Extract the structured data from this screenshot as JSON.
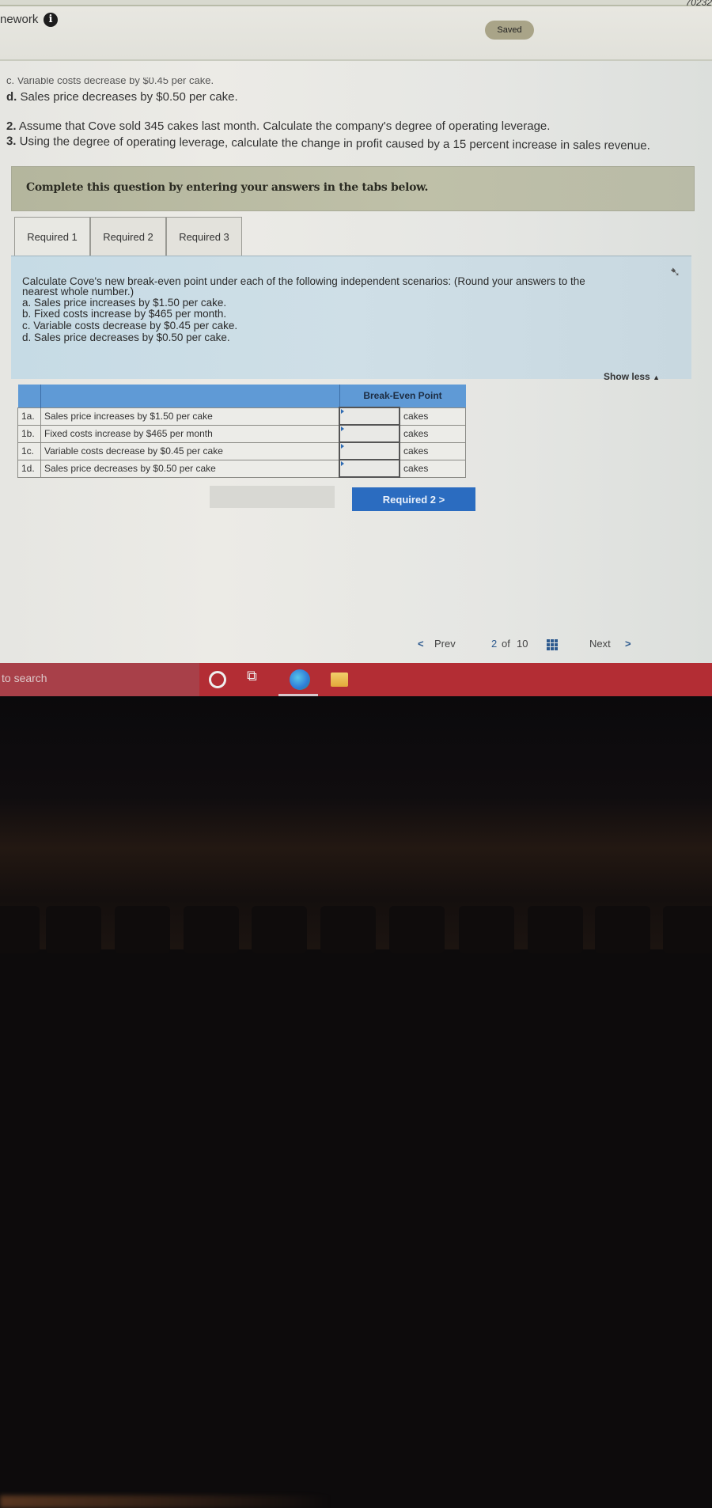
{
  "header": {
    "title": "nework",
    "info_icon": "info-icon",
    "saved_label": "Saved",
    "top_code": "70232"
  },
  "previous_text": {
    "line_c_cut": "c. Variable costs decrease by $0.45 per cake.",
    "line_d_prefix": "d.",
    "line_d": "Sales price decreases by $0.50 per cake.",
    "q2_num": "2.",
    "q2": "Assume that Cove sold 345 cakes last month. Calculate the company's degree of operating leverage.",
    "q3_num": "3.",
    "q3": "Using the degree of operating leverage, calculate the change in profit caused by a 15 percent increase in sales revenue."
  },
  "instruction": "Complete this question by entering your answers in the tabs below.",
  "tabs": [
    {
      "label": "Required 1",
      "active": true
    },
    {
      "label": "Required 2",
      "active": false
    },
    {
      "label": "Required 3",
      "active": false
    }
  ],
  "question_panel": {
    "intro": "Calculate Cove's new break-even point under each of the following independent scenarios: (Round your answers to the",
    "intro2": "nearest whole number.)",
    "items": [
      "a. Sales price increases by $1.50 per cake.",
      "b. Fixed costs increase by $465 per month.",
      "c. Variable costs decrease by $0.45 per cake.",
      "d. Sales price decreases by $0.50 per cake."
    ],
    "show_less": "Show less",
    "show_less_icon": "▲"
  },
  "answer_table": {
    "header": "Break-Even Point",
    "rows": [
      {
        "label": "1a.",
        "desc": "Sales price increases by $1.50 per cake",
        "value": "",
        "unit": "cakes"
      },
      {
        "label": "1b.",
        "desc": "Fixed costs increase by $465 per month",
        "value": "",
        "unit": "cakes"
      },
      {
        "label": "1c.",
        "desc": "Variable costs decrease by $0.45 per cake",
        "value": "",
        "unit": "cakes"
      },
      {
        "label": "1d.",
        "desc": "Sales price decreases by $0.50 per cake",
        "value": "",
        "unit": "cakes"
      }
    ]
  },
  "next_tab_button": "Required 2  >",
  "pagination": {
    "prev_icon": "<",
    "prev": "Prev",
    "page": "2",
    "of": "of",
    "total": "10",
    "next": "Next",
    "next_icon": ">"
  },
  "taskbar": {
    "search_placeholder": "to search"
  }
}
